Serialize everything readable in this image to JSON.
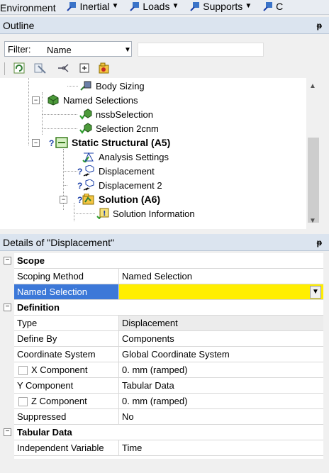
{
  "menubar": {
    "items": [
      {
        "label": "Environment",
        "has_icon": false,
        "has_caret": false
      },
      {
        "label": "Inertial",
        "has_icon": true,
        "has_caret": true
      },
      {
        "label": "Loads",
        "has_icon": true,
        "has_caret": true
      },
      {
        "label": "Supports",
        "has_icon": true,
        "has_caret": true
      },
      {
        "label": "C",
        "has_icon": true,
        "has_caret": false
      }
    ]
  },
  "outline": {
    "title": "Outline",
    "pin": "p",
    "filter_label": "Filter:",
    "filter_value": "Name",
    "search_value": "",
    "tree": [
      {
        "label": "Body Sizing",
        "icon": "mesh-sizing-icon",
        "bold": false
      },
      {
        "label": "Named Selections",
        "icon": "named-selections-icon",
        "bold": false
      },
      {
        "label": "nssbSelection",
        "icon": "named-selection-icon",
        "bold": false
      },
      {
        "label": "Selection 2cnm",
        "icon": "named-selection-icon",
        "bold": false
      },
      {
        "label": "Static Structural (A5)",
        "icon": "static-structural-icon",
        "bold": true
      },
      {
        "label": "Analysis Settings",
        "icon": "analysis-settings-icon",
        "bold": false
      },
      {
        "label": "Displacement",
        "icon": "displacement-icon",
        "bold": false
      },
      {
        "label": "Displacement 2",
        "icon": "displacement-icon",
        "bold": false
      },
      {
        "label": "Solution (A6)",
        "icon": "solution-icon",
        "bold": true
      },
      {
        "label": "Solution Information",
        "icon": "solution-information-icon",
        "bold": false
      }
    ]
  },
  "details": {
    "title": "Details of \"Displacement\"",
    "groups": {
      "scope": "Scope",
      "definition": "Definition",
      "tabular": "Tabular Data"
    },
    "rows": {
      "scoping_method": {
        "label": "Scoping Method",
        "value": "Named Selection"
      },
      "named_selection": {
        "label": "Named Selection",
        "value": ""
      },
      "type": {
        "label": "Type",
        "value": "Displacement"
      },
      "define_by": {
        "label": "Define By",
        "value": "Components"
      },
      "coordinate_system": {
        "label": "Coordinate System",
        "value": "Global Coordinate System"
      },
      "x_component": {
        "label": "X Component",
        "value": "0. mm  (ramped)"
      },
      "y_component": {
        "label": "Y Component",
        "value": "Tabular Data"
      },
      "z_component": {
        "label": "Z Component",
        "value": "0. mm  (ramped)"
      },
      "suppressed": {
        "label": "Suppressed",
        "value": "No"
      },
      "independent_variable": {
        "label": "Independent Variable",
        "value": "Time"
      }
    }
  },
  "colors": {
    "selected_row": "#3c78d8",
    "highlight_yellow": "#ffee00",
    "header_bg": "#dbe4ef"
  }
}
